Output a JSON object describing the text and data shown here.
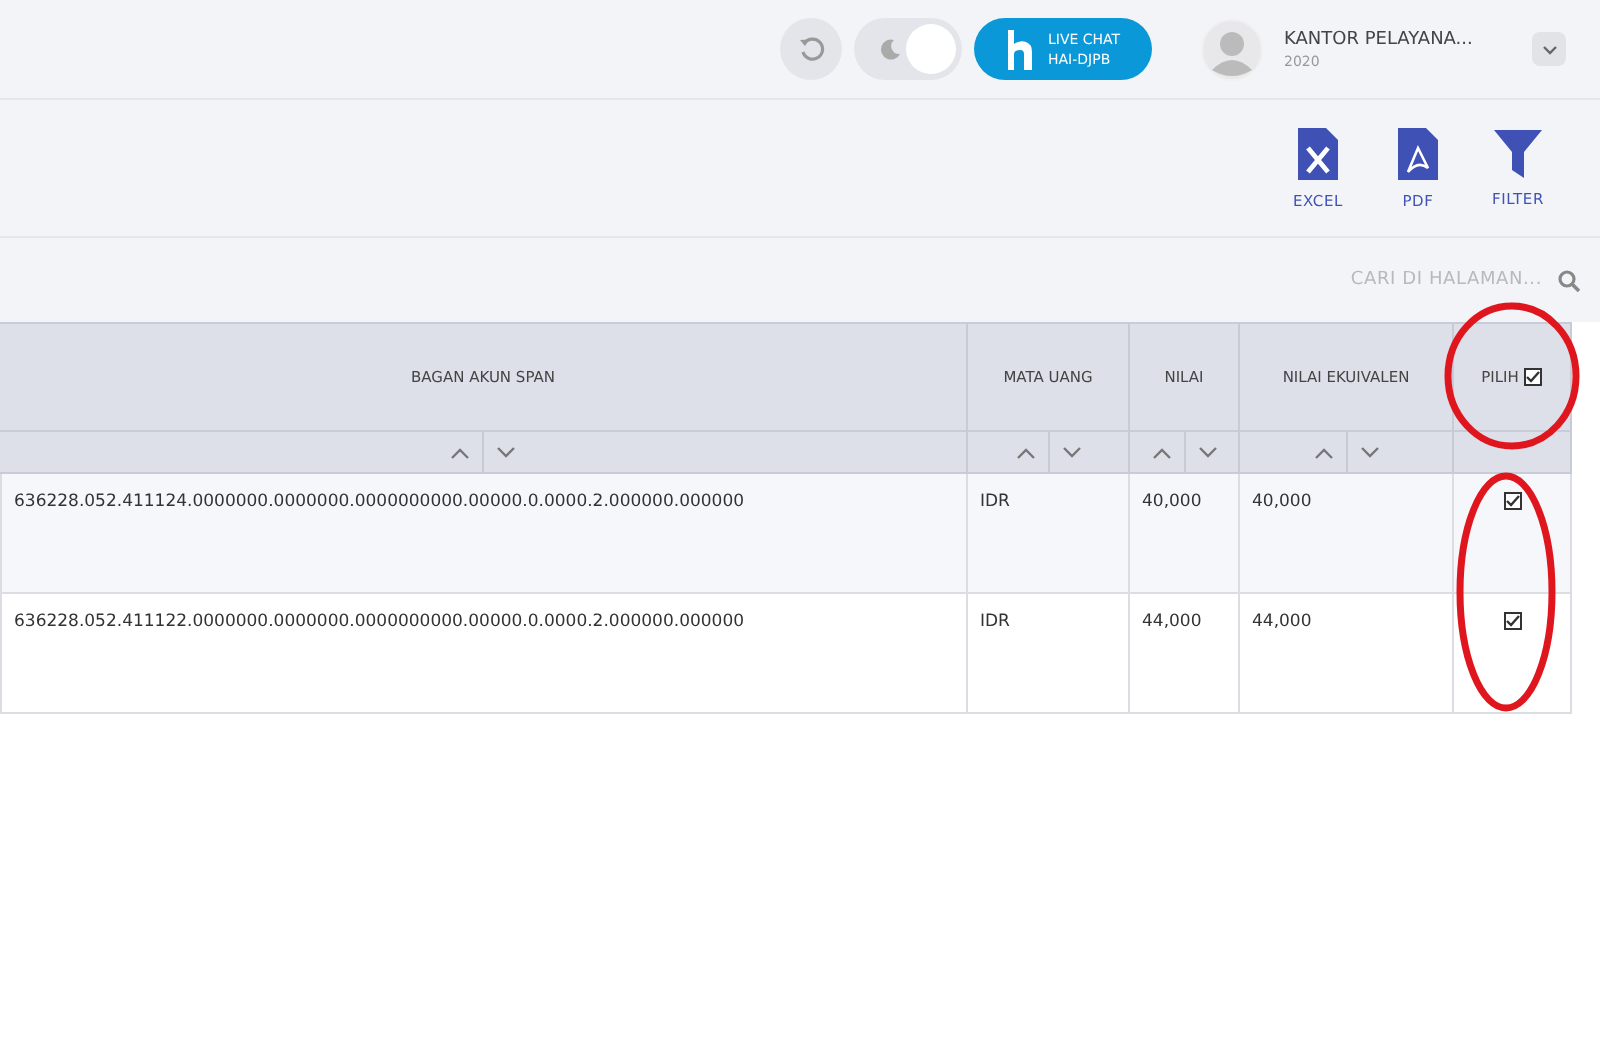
{
  "topbar": {
    "dark_mode": {
      "on": true
    },
    "chat": {
      "line1": "LIVE CHAT",
      "line2": "HAI-DJPB"
    },
    "user": {
      "name": "KANTOR PELAYANA...",
      "year": "2020"
    }
  },
  "toolbar": [
    {
      "kind": "excel",
      "label": "EXCEL"
    },
    {
      "kind": "pdf",
      "label": "PDF"
    },
    {
      "kind": "filter",
      "label": "FILTER"
    }
  ],
  "search": {
    "placeholder": "CARI DI HALAMAN..."
  },
  "table": {
    "columns": [
      "BAGAN AKUN SPAN",
      "MATA UANG",
      "NILAI",
      "NILAI EKUIVALEN",
      "PILIH"
    ],
    "select_all": {
      "checked": true
    },
    "rows": [
      {
        "cells": [
          "636228.052.411124.0000000.0000000.0000000000.00000.0.0000.2.000000.000000",
          "IDR",
          "40,000",
          "40,000"
        ],
        "checked": true
      },
      {
        "cells": [
          "636228.052.411122.0000000.0000000.0000000000.00000.0.0000.2.000000.000000",
          "IDR",
          "44,000",
          "44,000"
        ],
        "checked": true
      }
    ]
  }
}
